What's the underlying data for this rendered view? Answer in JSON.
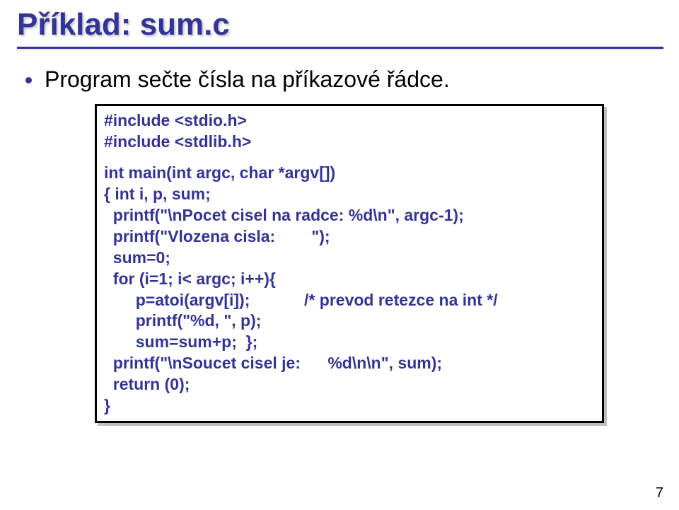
{
  "title": "Příklad: sum.c",
  "bullet": "Program sečte čísla na příkazové řádce.",
  "code": {
    "l01": "#include <stdio.h>",
    "l02": "#include <stdlib.h>",
    "l03": "int main(int argc, char *argv[])",
    "l04": "{ int i, p, sum;",
    "l05": "  printf(\"\\nPocet cisel na radce: %d\\n\", argc-1);",
    "l06": "  printf(\"Vlozena cisla:        \");",
    "l07": "  sum=0;",
    "l08": "  for (i=1; i< argc; i++){",
    "l09": "       p=atoi(argv[i]);            /* prevod retezce na int */",
    "l10": "       printf(\"%d, \", p);",
    "l11": "       sum=sum+p;  };",
    "l12": "  printf(\"\\nSoucet cisel je:      %d\\n\\n\", sum);",
    "l13": "  return (0);",
    "l14": "}"
  },
  "pageNumber": "7"
}
